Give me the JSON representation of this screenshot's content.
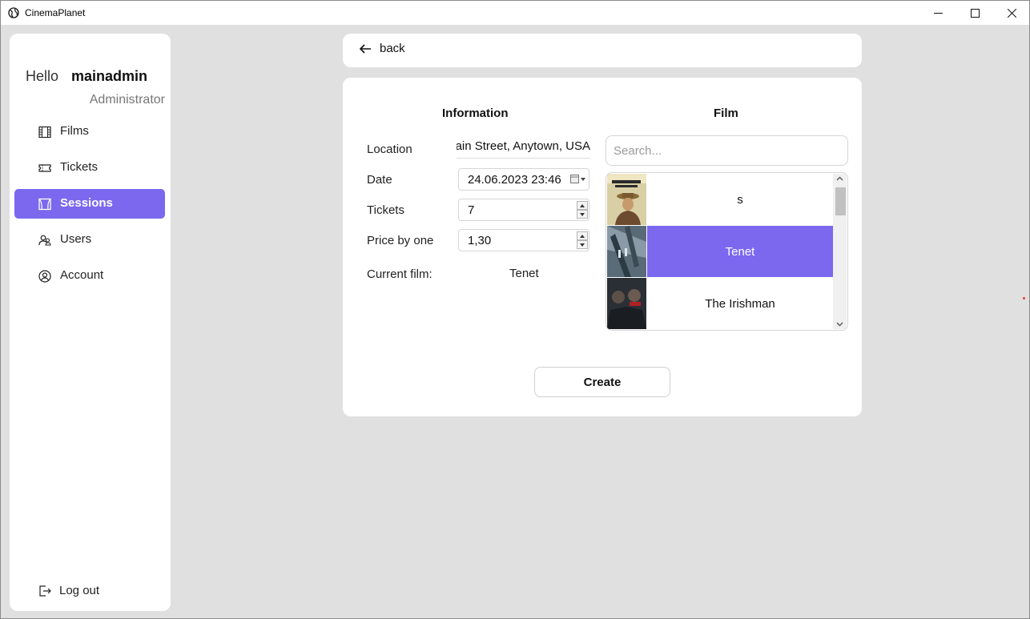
{
  "window": {
    "title": "CinemaPlanet",
    "icons": {
      "app": "globe-icon",
      "minimize": "minimize-icon",
      "maximize": "maximize-icon",
      "close": "close-icon"
    }
  },
  "sidebar": {
    "greeting": "Hello",
    "username": "mainadmin",
    "role": "Administrator",
    "items": [
      {
        "label": "Films",
        "icon": "film-icon",
        "active": false
      },
      {
        "label": "Tickets",
        "icon": "ticket-icon",
        "active": false
      },
      {
        "label": "Sessions",
        "icon": "theater-icon",
        "active": true
      },
      {
        "label": "Users",
        "icon": "users-icon",
        "active": false
      },
      {
        "label": "Account",
        "icon": "account-icon",
        "active": false
      }
    ],
    "logout_label": "Log out"
  },
  "back": {
    "label": "back"
  },
  "info": {
    "title": "Information",
    "location_label": "Location",
    "location_value": "ain Street, Anytown, USA",
    "date_label": "Date",
    "date_value": "24.06.2023 23:46",
    "tickets_label": "Tickets",
    "tickets_value": "7",
    "price_label": "Price by one",
    "price_value": "1,30",
    "current_film_label": "Current film:",
    "current_film_value": "Tenet"
  },
  "film": {
    "title": "Film",
    "search_placeholder": "Search...",
    "items": [
      {
        "title": "s",
        "selected": false
      },
      {
        "title": "Tenet",
        "selected": true
      },
      {
        "title": "The Irishman",
        "selected": false
      }
    ]
  },
  "create_label": "Create",
  "colors": {
    "accent": "#7b68ee",
    "background": "#e0e0e0",
    "card": "#ffffff"
  }
}
